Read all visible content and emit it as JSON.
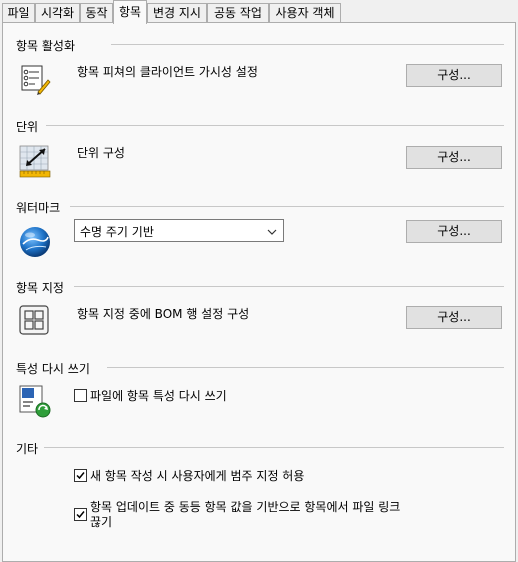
{
  "tabs": [
    "파일",
    "시각화",
    "동작",
    "항목",
    "변경 지시",
    "공동 작업",
    "사용자 객체"
  ],
  "active_tab": "항목",
  "sections": {
    "activation": {
      "title": "항목 활성화",
      "desc": "항목 피쳐의 클라이언트 가시성 설정",
      "button": "구성...",
      "icon": "checklist-pencil-icon"
    },
    "units": {
      "title": "단위",
      "desc": "단위 구성",
      "button": "구성...",
      "icon": "ruler-units-icon"
    },
    "watermark": {
      "title": "워터마크",
      "select_value": "수명 주기 기반",
      "button": "구성...",
      "icon": "globe-icon"
    },
    "item_assign": {
      "title": "항목 지정",
      "desc": "항목 지정 중에 BOM 행 설정 구성",
      "button": "구성...",
      "icon": "grid-icon"
    },
    "property_write": {
      "title": "특성 다시 쓰기",
      "checkbox_label": "파일에 항목 특성 다시 쓰기",
      "checked": false,
      "icon": "property-sync-icon"
    },
    "other": {
      "title": "기타",
      "checkbox1_label": "새 항목 작성 시 사용자에게 범주 지정 허용",
      "checkbox1_checked": true,
      "checkbox2_label_line1": "항목 업데이트 중 동등 항목 값을 기반으로 항목에서 파일 링크",
      "checkbox2_label_line2": "끊기",
      "checkbox2_checked": true
    }
  }
}
